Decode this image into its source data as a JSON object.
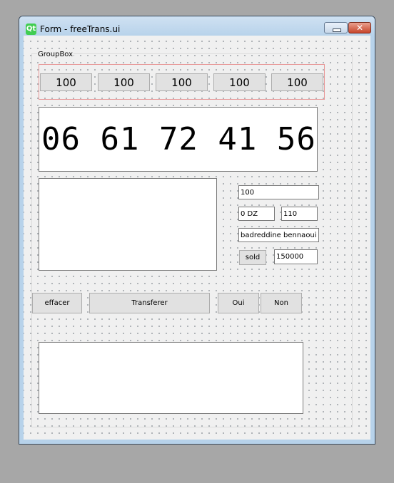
{
  "window": {
    "title": "Form - freeTrans.ui",
    "logo_text": "Qt",
    "close_glyph": "✕"
  },
  "groupbox": {
    "title": "GroupBox"
  },
  "number_buttons": [
    "100",
    "100",
    "100",
    "100",
    "100"
  ],
  "display": {
    "value": "06 61 72 41 56"
  },
  "fields": {
    "amount": "100",
    "currency": "0 DZ",
    "code": "110",
    "name": "badreddine bennaoui",
    "sold_label": "sold",
    "sold_value": "150000"
  },
  "actions": {
    "effacer": "effacer",
    "transferer": "Transferer",
    "oui": "Oui",
    "non": "Non"
  },
  "icons": [
    "qt-logo-icon",
    "minimize-icon",
    "close-icon"
  ],
  "colors": {
    "selection_border": "#e89a9a",
    "close_button": "#c7452a",
    "titlebar": "#b7d2ea",
    "qt_green": "#41cd52"
  }
}
